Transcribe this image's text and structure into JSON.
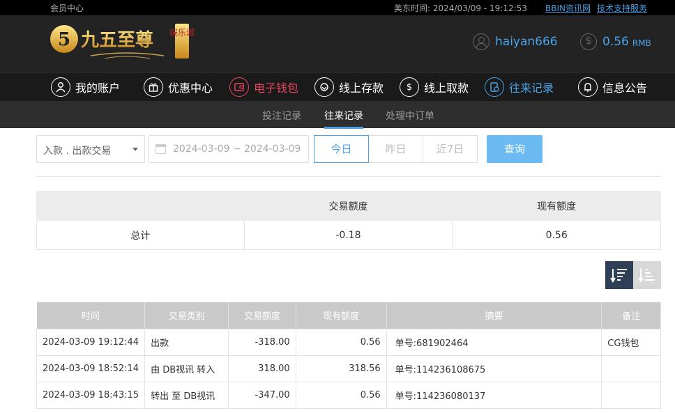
{
  "topbar": {
    "member_center": "会员中心",
    "time_label": "美东时间:",
    "time_value": "2024/03/09 - 19:12:53",
    "link_news": "BBIN资讯网",
    "link_support": "技术支持服务"
  },
  "header": {
    "logo_digit": "5",
    "logo_text": "九五至尊",
    "logo_side": "娱乐城",
    "username": "haiyan666",
    "balance": "0.56",
    "currency": "RMB"
  },
  "nav": [
    {
      "label": "我的账户",
      "icon": "user-icon"
    },
    {
      "label": "优惠中心",
      "icon": "gift-icon"
    },
    {
      "label": "电子钱包",
      "icon": "wallet-icon"
    },
    {
      "label": "线上存款",
      "icon": "deposit-icon"
    },
    {
      "label": "线上取款",
      "icon": "withdraw-icon"
    },
    {
      "label": "往来记录",
      "icon": "record-icon"
    },
    {
      "label": "信息公告",
      "icon": "bell-icon"
    }
  ],
  "subnav": [
    "投注记录",
    "往来记录",
    "处理中订单"
  ],
  "filters": {
    "type_select": "入款 . 出款交易",
    "date_range": "2024-03-09 ~ 2024-03-09",
    "btn_today": "今日",
    "btn_yesterday": "昨日",
    "btn_7days": "近7日",
    "btn_query": "查询"
  },
  "summary": {
    "col_trade": "交易额度",
    "col_current": "现有额度",
    "row_label": "总计",
    "trade_value": "-0.18",
    "current_value": "0.56"
  },
  "table": {
    "headers": [
      "时间",
      "交易类别",
      "交易额度",
      "现有额度",
      "摘要",
      "备注"
    ],
    "rows": [
      [
        "2024-03-09 19:12:44",
        "出款",
        "-318.00",
        "0.56",
        "单号:681902464",
        "CG钱包"
      ],
      [
        "2024-03-09 18:52:14",
        "由 DB视讯 转入",
        "318.00",
        "318.56",
        "单号:114236108675",
        ""
      ],
      [
        "2024-03-09 18:43:15",
        "转出 至 DB视讯",
        "-347.00",
        "0.56",
        "单号:114236080137",
        ""
      ]
    ]
  },
  "colors": {
    "accent_blue": "#4aa3e8",
    "accent_red": "#e8445f",
    "query_button": "#6bbaf2",
    "header_bg": "#232323"
  }
}
